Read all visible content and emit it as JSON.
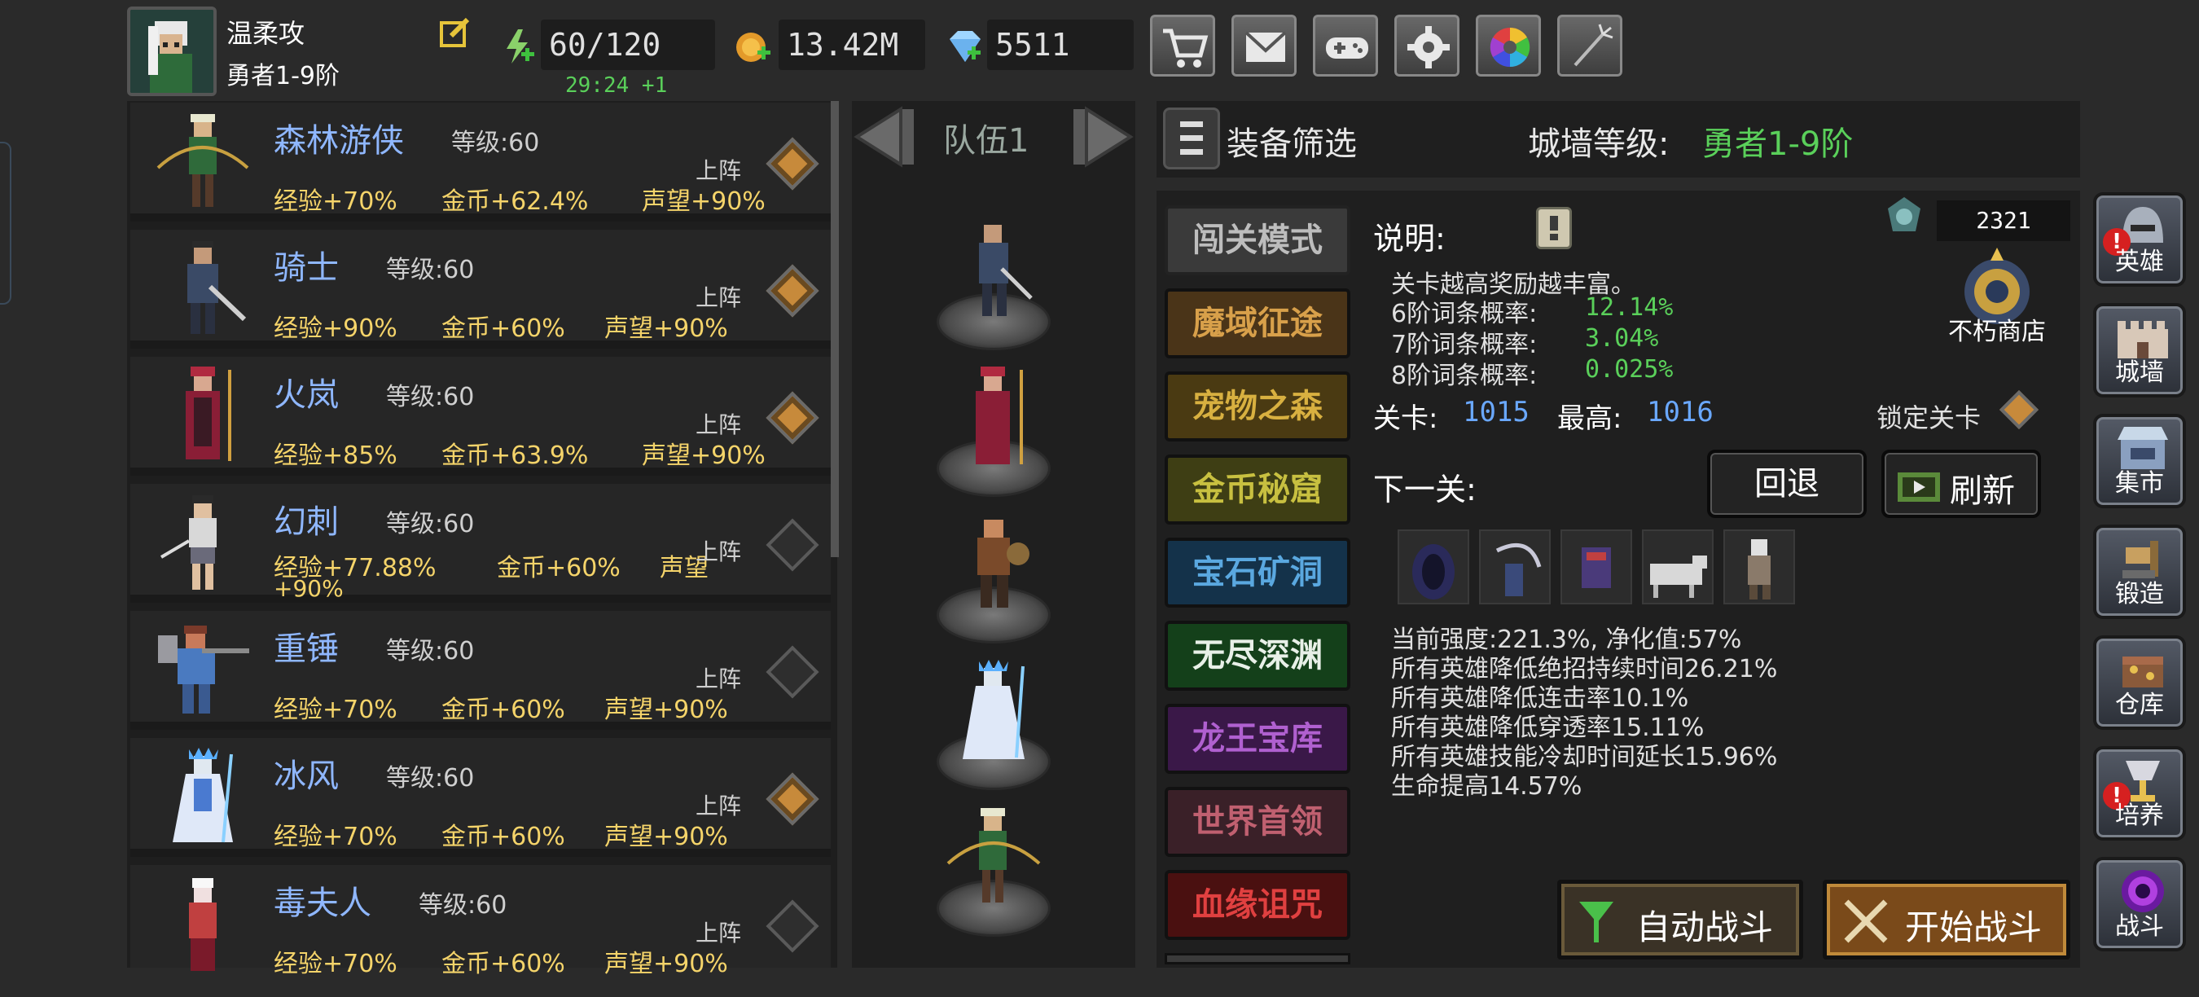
{
  "player": {
    "name": "温柔攻",
    "rank": "勇者1-9阶"
  },
  "resources": {
    "stamina": "60/120",
    "stamina_timer": "29:24 +1",
    "gold": "13.42M",
    "diamond": "5511"
  },
  "top_icons": [
    "cart-icon",
    "mail-icon",
    "gamepad-icon",
    "gear-icon",
    "color-wheel-icon",
    "firework-icon"
  ],
  "heroes": [
    {
      "name": "森林游侠",
      "level": "等级:60",
      "exp": "经验+70%",
      "gold": "金币+62.4%",
      "fame": "声望+90%",
      "deploy": "上阵",
      "deployed": true
    },
    {
      "name": "骑士",
      "level": "等级:60",
      "exp": "经验+90%",
      "gold": "金币+60%",
      "fame": "声望+90%",
      "deploy": "上阵",
      "deployed": true
    },
    {
      "name": "火岚",
      "level": "等级:60",
      "exp": "经验+85%",
      "gold": "金币+63.9%",
      "fame": "声望+90%",
      "deploy": "上阵",
      "deployed": true
    },
    {
      "name": "幻刺",
      "level": "等级:60",
      "exp": "经验+77.88%",
      "gold": "金币+60%",
      "fame": "声望",
      "fame2": "+90%",
      "deploy": "上阵",
      "deployed": false
    },
    {
      "name": "重锤",
      "level": "等级:60",
      "exp": "经验+70%",
      "gold": "金币+60%",
      "fame": "声望+90%",
      "deploy": "上阵",
      "deployed": false
    },
    {
      "name": "冰风",
      "level": "等级:60",
      "exp": "经验+70%",
      "gold": "金币+60%",
      "fame": "声望+90%",
      "deploy": "上阵",
      "deployed": true
    },
    {
      "name": "毒夫人",
      "level": "等级:60",
      "exp": "经验+70%",
      "gold": "金币+60%",
      "fame": "声望+90%",
      "deploy": "上阵",
      "deployed": false
    }
  ],
  "team": {
    "label": "队伍1"
  },
  "equip_filter": "装备筛选",
  "wall_level": {
    "label": "城墙等级:",
    "value": "勇者1-9阶"
  },
  "modes": [
    "闯关模式",
    "魔域征途",
    "宠物之森",
    "金币秘窟",
    "宝石矿洞",
    "无尽深渊",
    "龙王宝库",
    "世界首领",
    "血缘诅咒"
  ],
  "desc": {
    "title": "说明:",
    "line1": "关卡越高奖励越丰富。",
    "r6_label": "6阶词条概率:",
    "r6": "12.14%",
    "r7_label": "7阶词条概率:",
    "r7": "3.04%",
    "r8_label": "8阶词条概率:",
    "r8": "0.025%"
  },
  "shop": {
    "count": "2321",
    "label": "不朽商店"
  },
  "stage": {
    "label": "关卡:",
    "value": "1015",
    "best_label": "最高:",
    "best": "1016",
    "lock": "锁定关卡"
  },
  "next": {
    "label": "下一关:",
    "back": "回退",
    "refresh": "刷新"
  },
  "effects": [
    "当前强度:221.3%, 净化值:57%",
    "所有英雄降低绝招持续时间26.21%",
    "所有英雄降低连击率10.1%",
    "所有英雄降低穿透率15.11%",
    "所有英雄技能冷却时间延长15.96%",
    "生命提高14.57%"
  ],
  "actions": {
    "auto": "自动战斗",
    "start": "开始战斗"
  },
  "side": [
    "英雄",
    "城墙",
    "集市",
    "锻造",
    "仓库",
    "培养",
    "战斗"
  ],
  "badge": "!"
}
